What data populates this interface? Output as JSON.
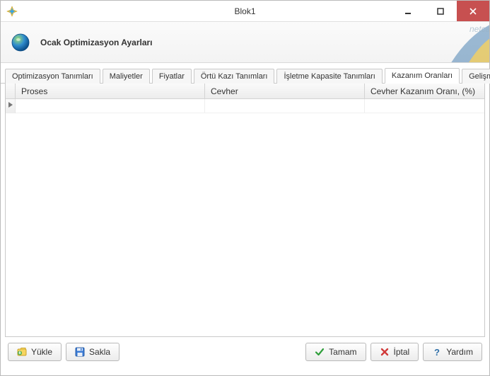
{
  "window": {
    "title": "Blok1"
  },
  "header": {
    "heading": "Ocak Optimizasyon Ayarları",
    "brand_text": "netcad"
  },
  "tabs": [
    {
      "label": "Optimizasyon Tanımları",
      "active": false
    },
    {
      "label": "Maliyetler",
      "active": false
    },
    {
      "label": "Fiyatlar",
      "active": false
    },
    {
      "label": "Örtü Kazı Tanımları",
      "active": false
    },
    {
      "label": "İşletme Kapasite Tanımları",
      "active": false
    },
    {
      "label": "Kazanım Oranları",
      "active": true
    },
    {
      "label": "Gelişmiş Ayarlar",
      "active": false
    }
  ],
  "grid": {
    "columns": [
      {
        "label": "Proses"
      },
      {
        "label": "Cevher"
      },
      {
        "label": "Cevher Kazanım Oranı, (%)"
      }
    ],
    "rows": []
  },
  "footer": {
    "load": "Yükle",
    "save": "Sakla",
    "ok": "Tamam",
    "cancel": "İptal",
    "help": "Yardım"
  }
}
